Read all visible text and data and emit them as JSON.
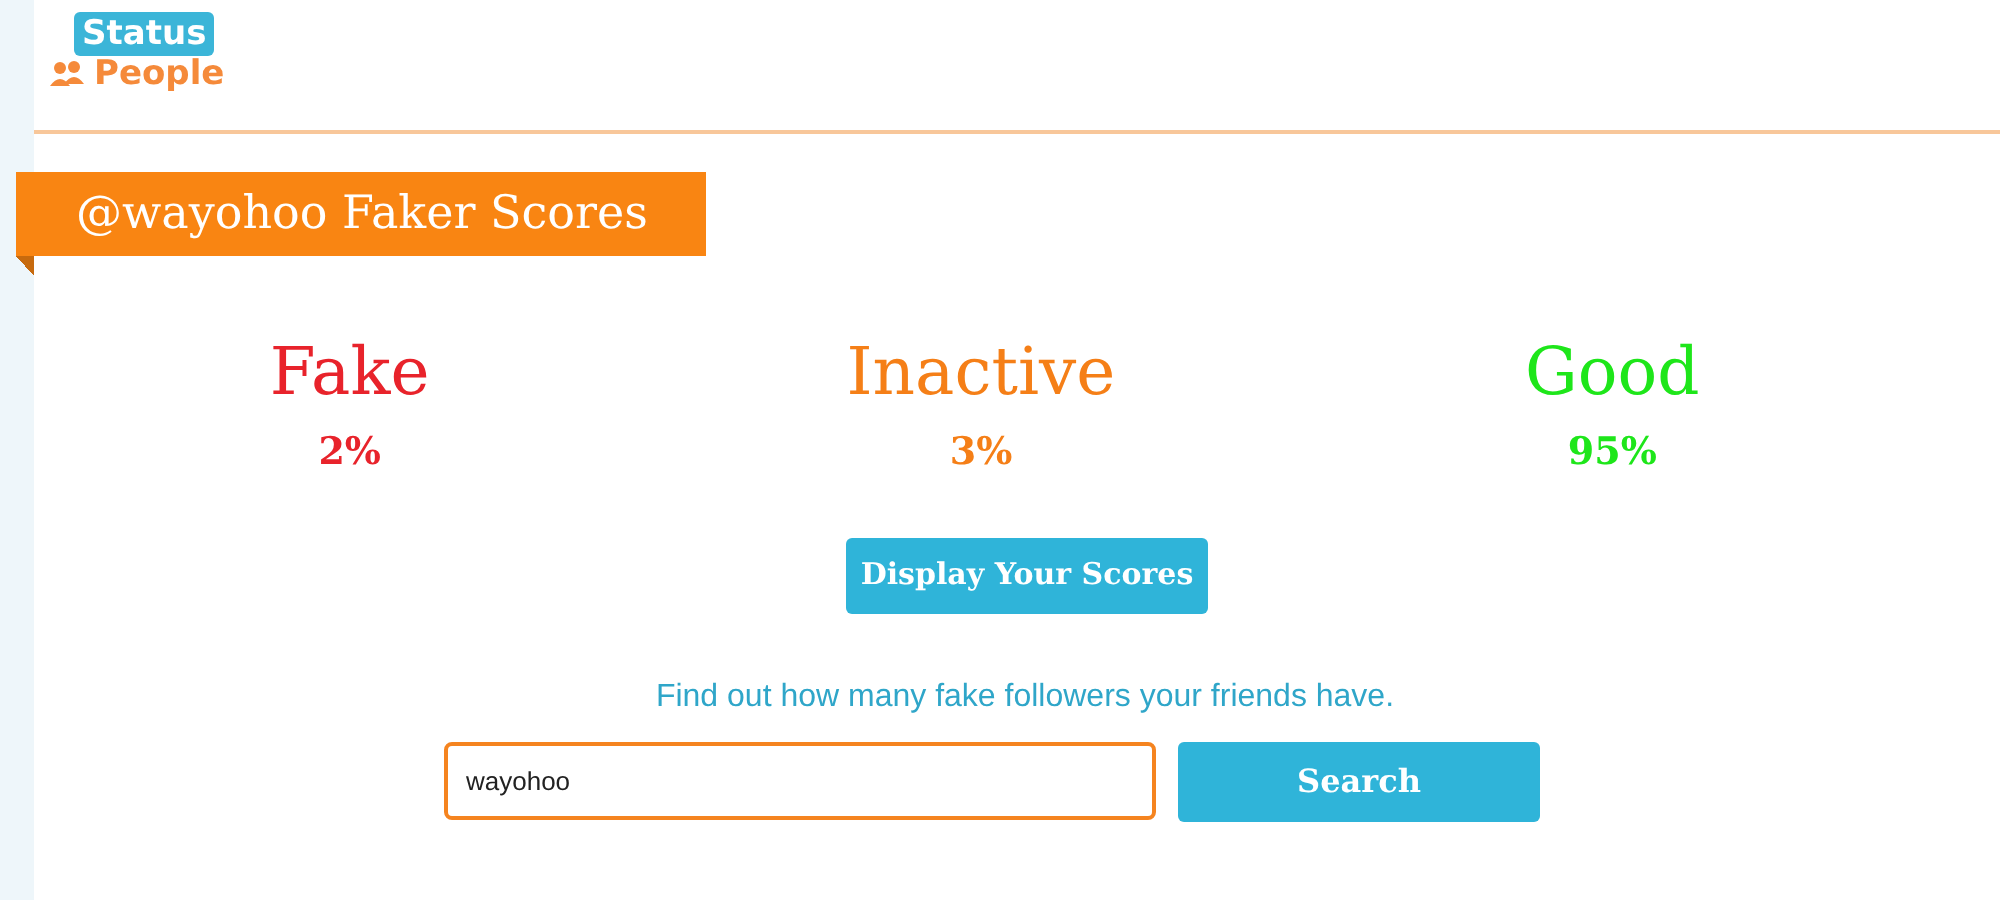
{
  "logo": {
    "top": "Status",
    "bottom": "People"
  },
  "banner": {
    "title": "@wayohoo Faker Scores"
  },
  "scores": [
    {
      "label": "Fake",
      "value": "2%",
      "color": "#e8232b"
    },
    {
      "label": "Inactive",
      "value": "3%",
      "color": "#f57f17"
    },
    {
      "label": "Good",
      "value": "95%",
      "color": "#1ee61a"
    }
  ],
  "display_button": "Display Your Scores",
  "prompt": "Find out how many fake followers your friends have.",
  "search": {
    "value": "wayohoo",
    "button": "Search"
  }
}
